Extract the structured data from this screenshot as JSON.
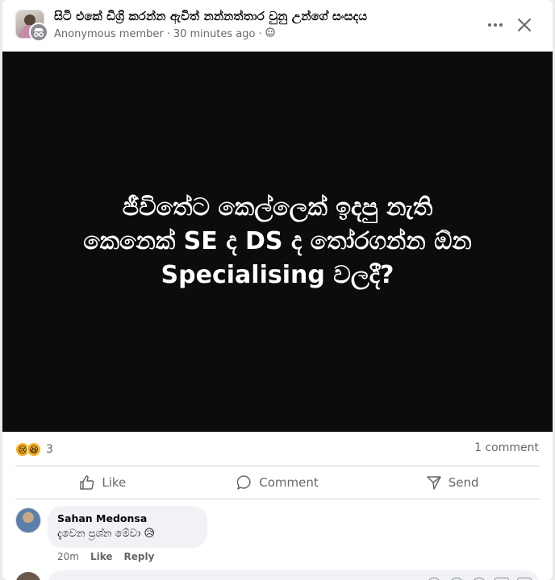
{
  "post": {
    "group_name": "සිටි එකේ ඩිග්‍රි කරන්න ඇවිත් නන්නත්තාර වුනු උන්ගේ සංසදය",
    "author": "Anonymous member",
    "time": "30 minutes ago",
    "privacy_icon": "globe-icon",
    "image_text_line1": "ජීවිතේට කෙල්ලෙක් ඉදපු නැති",
    "image_text_line2": "කෙනෙක් SE ද DS ද තෝරගන්න ඕන",
    "image_text_line3": "Specialising වලදී?",
    "image_background": "#0c0c0c"
  },
  "stats": {
    "reaction_icons": [
      "sad-reaction-icon",
      "haha-reaction-icon"
    ],
    "reaction_count": "3",
    "comment_count": "1 comment"
  },
  "actions": {
    "like": "Like",
    "comment": "Comment",
    "send": "Send"
  },
  "comments": [
    {
      "author": "Sahan Medonsa",
      "text": "දැවෙන ප්‍රශ්න මේවා 😥",
      "time": "20m",
      "like": "Like",
      "reply": "Reply"
    }
  ],
  "colors": {
    "text_primary": "#050505",
    "text_secondary": "#65676b",
    "divider": "#ced0d4",
    "bubble": "#f0f2f5"
  }
}
